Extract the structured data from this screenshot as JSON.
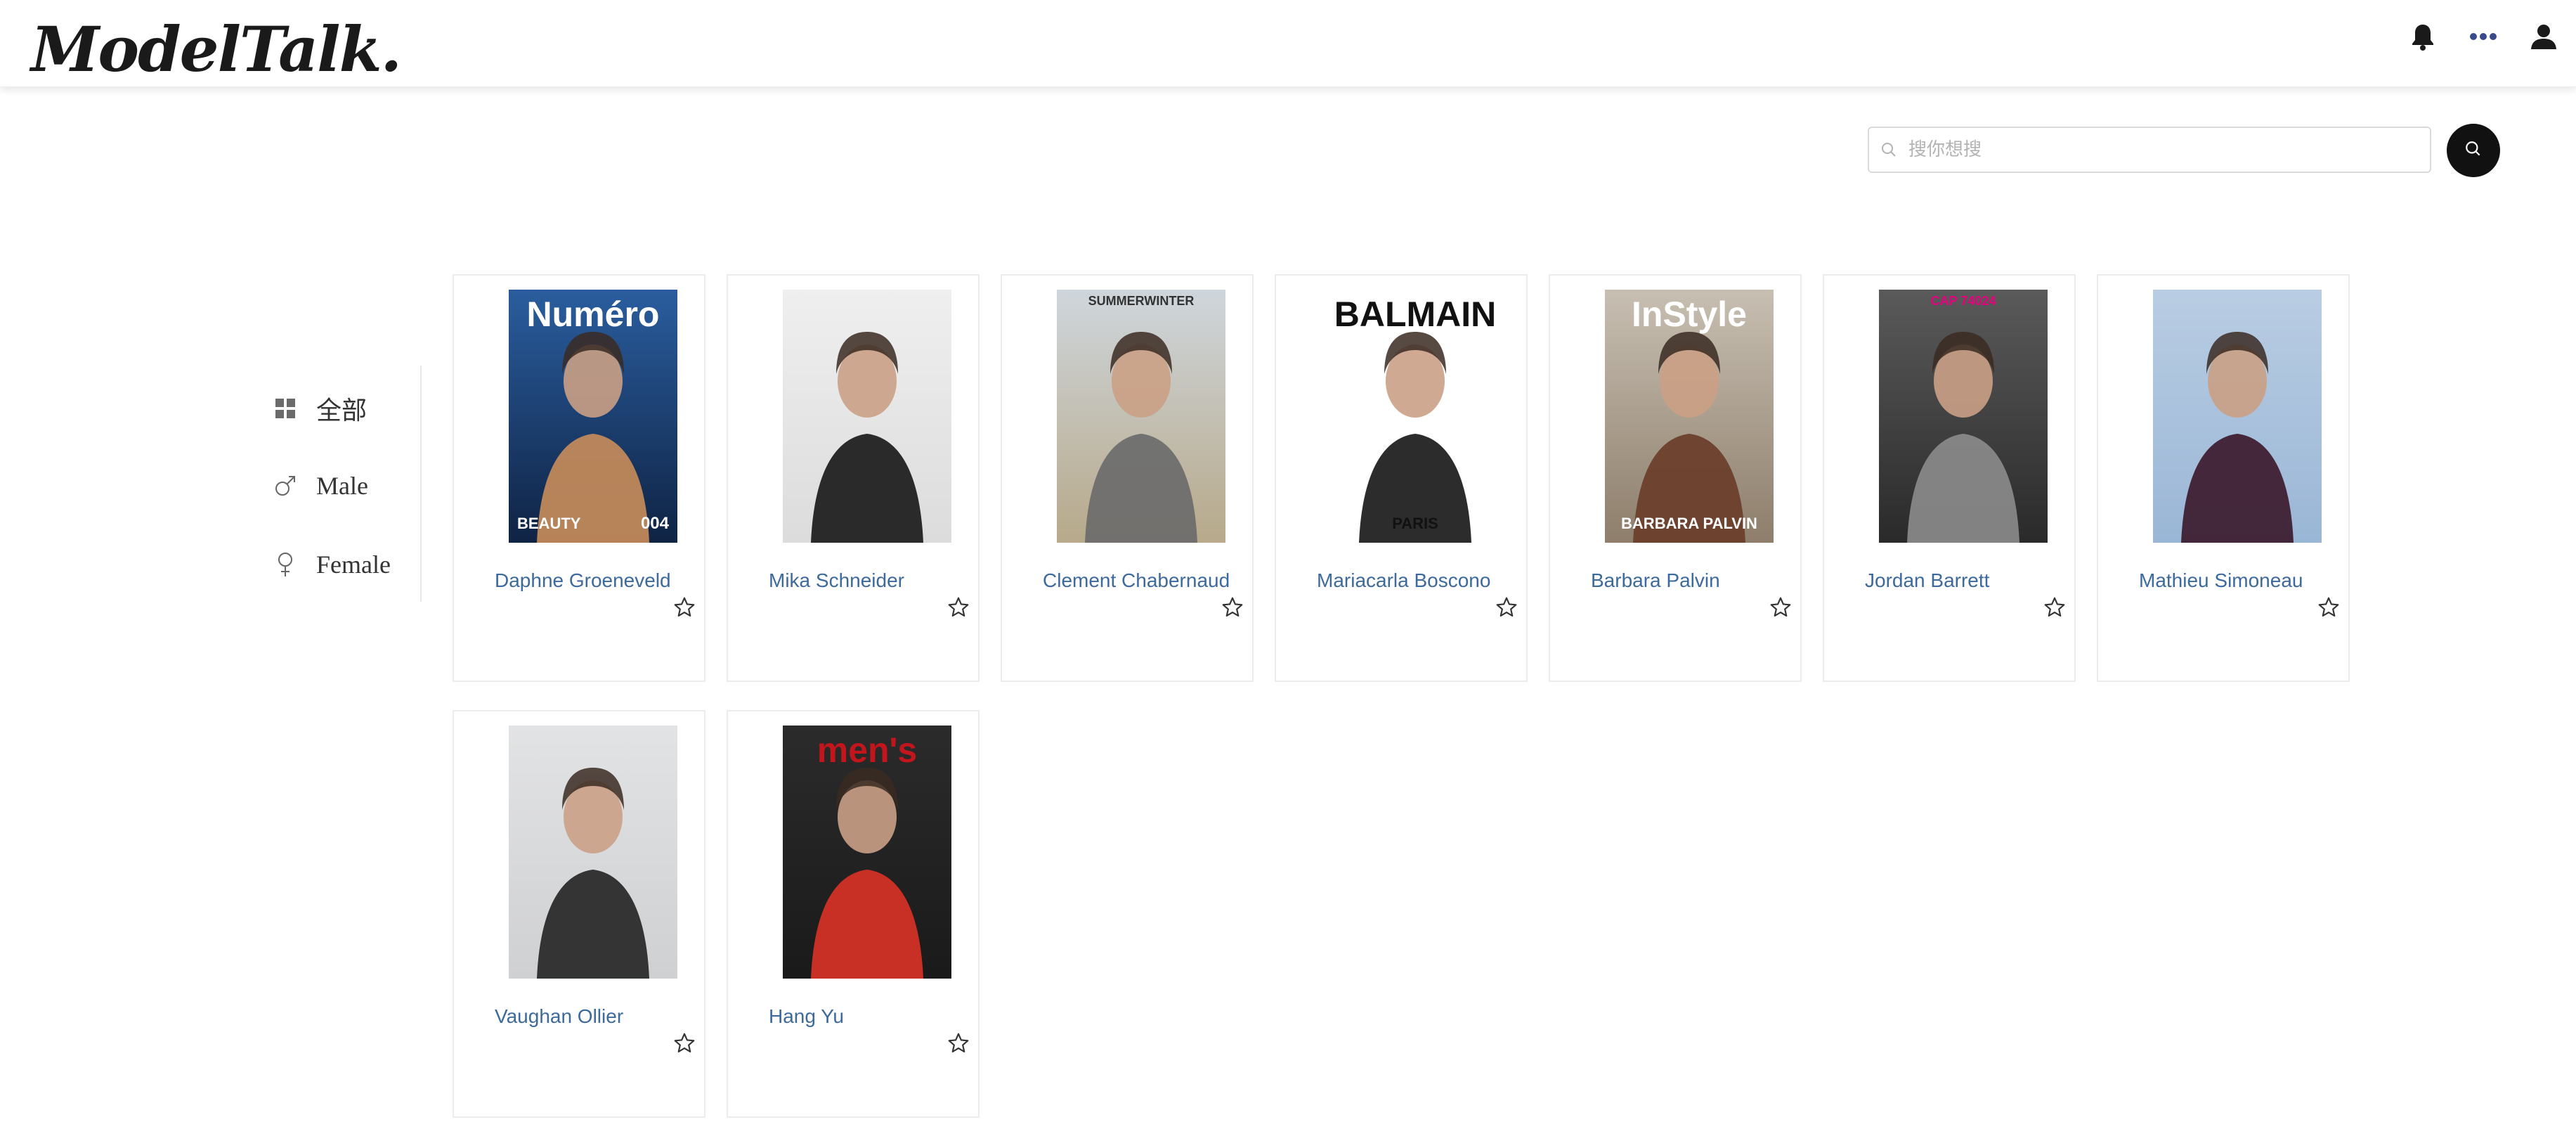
{
  "header": {
    "logo": "ModelTalk.",
    "icons": [
      "bell-icon",
      "more-icon",
      "user-icon"
    ]
  },
  "search": {
    "placeholder": "搜你想搜",
    "value": "",
    "icon": "search-icon",
    "button_icon": "search-icon"
  },
  "sidebar": {
    "items": [
      {
        "label": "全部",
        "icon": "grid-icon"
      },
      {
        "label": "Male",
        "icon": "male-icon"
      },
      {
        "label": "Female",
        "icon": "female-icon"
      }
    ]
  },
  "models": [
    {
      "name": "Daphne Groeneveld",
      "cover": {
        "masthead": "Numéro",
        "masthead_color": "#ffffff",
        "sub": "BEAUTY",
        "issue": "004",
        "bg": [
          "#2a5d9e",
          "#0f2344"
        ],
        "accent": "#c58b5a"
      }
    },
    {
      "name": "Mika Schneider",
      "cover": {
        "bg": [
          "#efefef",
          "#dcdcdc"
        ],
        "accent": "#1a1a1a"
      }
    },
    {
      "name": "Clement Chabernaud",
      "cover": {
        "masthead": "SUMMERWINTER",
        "masthead_color": "#333333",
        "bg": [
          "#cfd6dc",
          "#b7a98a"
        ],
        "accent": "#6b6b6b"
      }
    },
    {
      "name": "Mariacarla Boscono",
      "cover": {
        "masthead": "BALMAIN",
        "sub": "PARIS",
        "masthead_color": "#111111",
        "bg": [
          "#ffffff",
          "#ffffff"
        ],
        "accent": "#1a1a1a"
      }
    },
    {
      "name": "Barbara Palvin",
      "cover": {
        "masthead": "InStyle",
        "sub": "BARBARA PALVIN",
        "masthead_color": "#ffffff",
        "bg": [
          "#c7bfb2",
          "#8e7e6b"
        ],
        "accent": "#6a3e2a"
      }
    },
    {
      "name": "Jordan Barrett",
      "cover": {
        "masthead": "CAP 74024",
        "masthead_color": "#e6007e",
        "bg": [
          "#5a5a5a",
          "#2a2a2a"
        ],
        "accent": "#8a8a8a"
      }
    },
    {
      "name": "Mathieu Simoneau",
      "cover": {
        "bg": [
          "#b9cde3",
          "#9ab6d6"
        ],
        "accent": "#3c1a2c"
      }
    },
    {
      "name": "Vaughan Ollier",
      "cover": {
        "bg": [
          "#e2e3e4",
          "#cfd0d2"
        ],
        "accent": "#262626"
      }
    },
    {
      "name": "Hang Yu",
      "cover": {
        "masthead": "men's",
        "masthead_color": "#c3161c",
        "bg": [
          "#2b2b2b",
          "#1a1a1a"
        ],
        "accent": "#d83226"
      }
    }
  ],
  "colors": {
    "name_link": "#3d6a9c",
    "search_button": "#111111"
  }
}
